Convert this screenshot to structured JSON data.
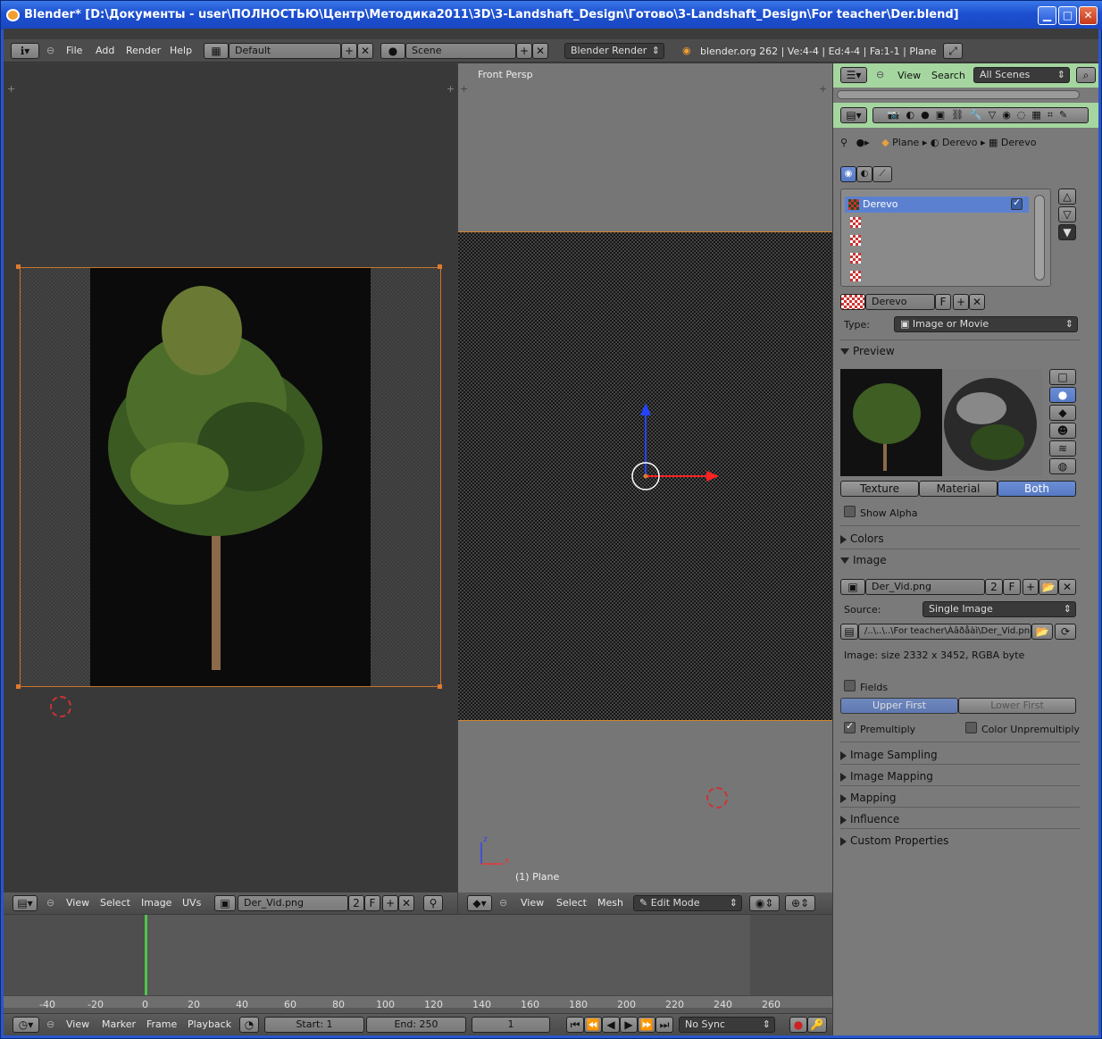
{
  "window": {
    "title": "Blender* [D:\\Документы - user\\ПОЛНОСТЬЮ\\Центр\\Методика2011\\3D\\3-Landshaft_Design\\Готово\\3-Landshaft_Design\\For teacher\\Der.blend]",
    "min": "▁",
    "max": "□",
    "close": "✕"
  },
  "topbar": {
    "menus": [
      "File",
      "Add",
      "Render",
      "Help"
    ],
    "layout": "Default",
    "scene": "Scene",
    "engine": "Blender Render",
    "info": "blender.org 262 | Ve:4-4 | Ed:4-4 | Fa:1-1 | Plane"
  },
  "uv_editor": {
    "menus": [
      "View",
      "Select",
      "Image",
      "UVs"
    ],
    "image": "Der_Vid.png",
    "users": "2",
    "fake": "F"
  },
  "viewport": {
    "label": "Front Persp",
    "object_label": "(1) Plane",
    "menus": [
      "View",
      "Select",
      "Mesh"
    ],
    "mode": "Edit Mode",
    "axis_x": "x",
    "axis_z": "z"
  },
  "outliner": {
    "menus": [
      "View",
      "Search"
    ],
    "filter": "All Scenes"
  },
  "properties": {
    "breadcrumb": [
      "Plane",
      "Derevo",
      "Derevo"
    ],
    "slot_selected": "Derevo",
    "texture_name": "Derevo",
    "texture_fake": "F",
    "type_label": "Type:",
    "type_value": "Image or Movie",
    "preview": {
      "title": "Preview",
      "tabs": [
        "Texture",
        "Material",
        "Both"
      ],
      "active_tab": "Both",
      "show_alpha": "Show Alpha"
    },
    "colors": "Colors",
    "image": {
      "title": "Image",
      "name": "Der_Vid.png",
      "users": "2",
      "fake": "F",
      "source_label": "Source:",
      "source_value": "Single Image",
      "path": "/..\\..\\..\\For teacher\\Àâðåàì\\Der_Vid.png",
      "size_info": "Image: size 2332 x 3452, RGBA byte",
      "fields": "Fields",
      "upper": "Upper First",
      "lower": "Lower First",
      "premultiply": "Premultiply",
      "color_unpremultiply": "Color Unpremultiply"
    },
    "collapsed": [
      "Image Sampling",
      "Image Mapping",
      "Mapping",
      "Influence",
      "Custom Properties"
    ]
  },
  "timeline": {
    "ticks": [
      "-40",
      "-20",
      "0",
      "20",
      "40",
      "60",
      "80",
      "100",
      "120",
      "140",
      "160",
      "180",
      "200",
      "220",
      "240",
      "260"
    ],
    "menus": [
      "View",
      "Marker",
      "Frame",
      "Playback"
    ],
    "start": "Start: 1",
    "end": "End: 250",
    "current": "1",
    "sync": "No Sync"
  }
}
